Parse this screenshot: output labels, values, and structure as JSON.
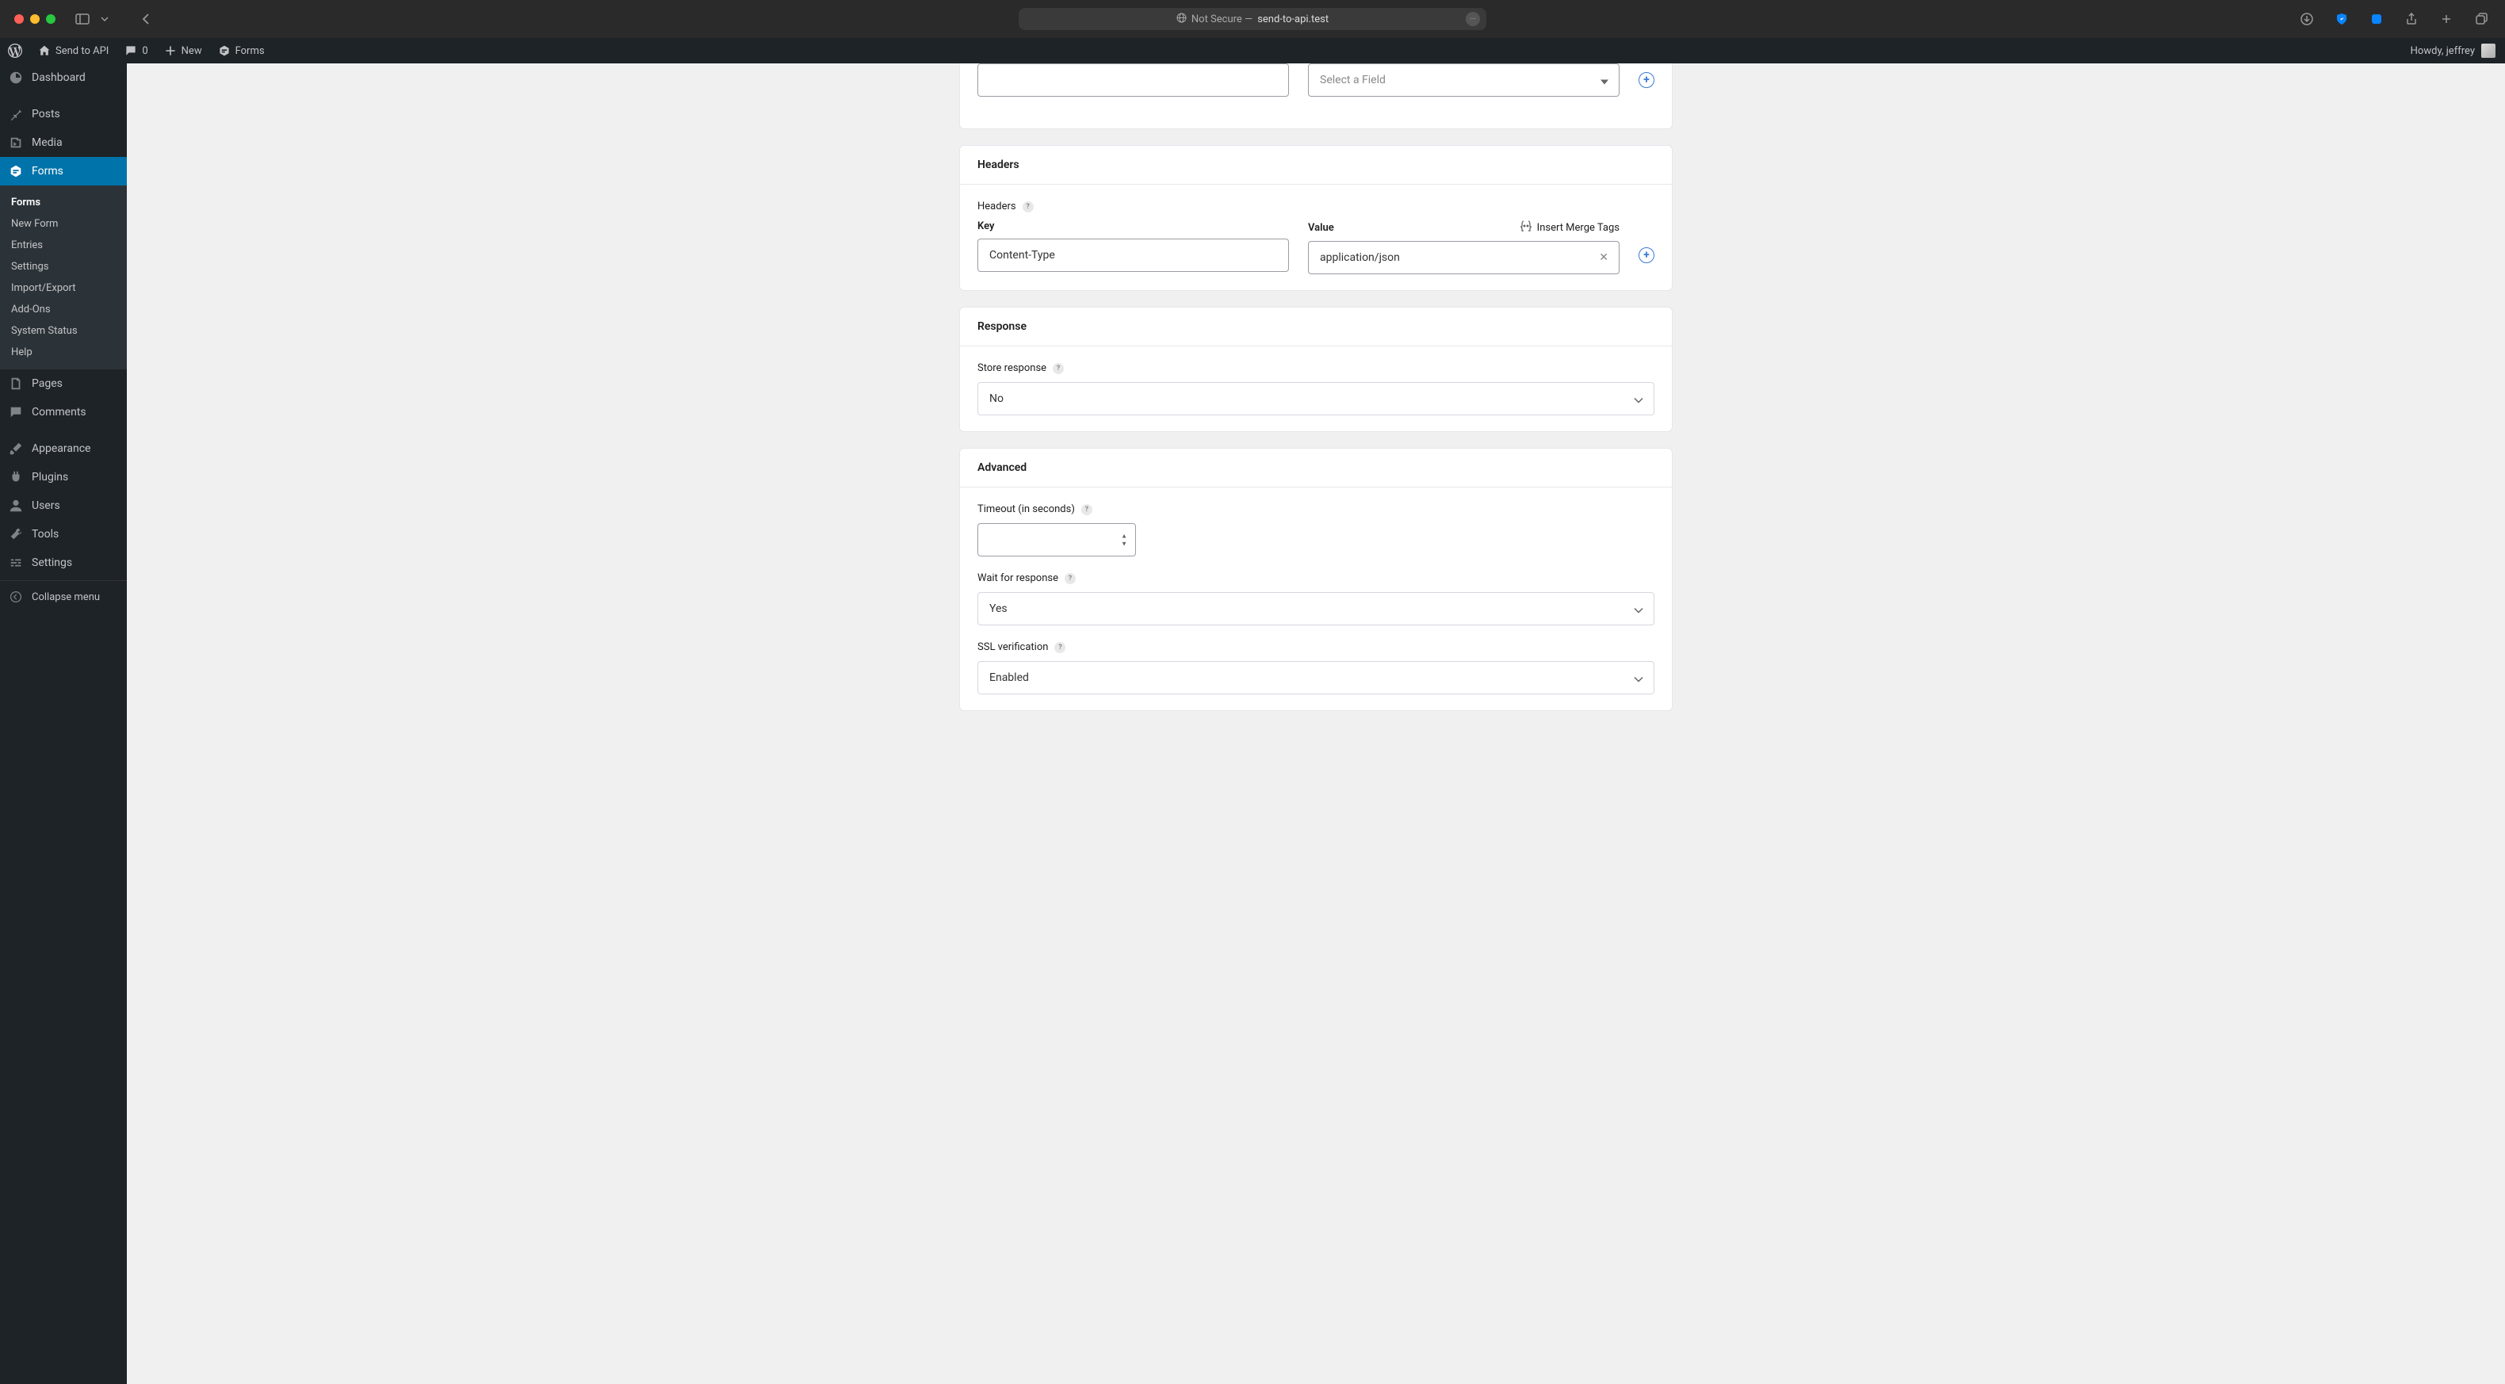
{
  "browser": {
    "url_prefix": "Not Secure —",
    "url": "send-to-api.test"
  },
  "adminbar": {
    "site_name": "Send to API",
    "comments_count": "0",
    "new_label": "New",
    "forms_label": "Forms",
    "howdy": "Howdy, jeffrey"
  },
  "sidebar": {
    "dashboard": "Dashboard",
    "posts": "Posts",
    "media": "Media",
    "forms": "Forms",
    "submenu": {
      "forms": "Forms",
      "new_form": "New Form",
      "entries": "Entries",
      "settings": "Settings",
      "import_export": "Import/Export",
      "addons": "Add-Ons",
      "system_status": "System Status",
      "help": "Help"
    },
    "pages": "Pages",
    "comments": "Comments",
    "appearance": "Appearance",
    "plugins": "Plugins",
    "users": "Users",
    "tools": "Tools",
    "settings": "Settings",
    "collapse": "Collapse menu"
  },
  "top_row": {
    "select_placeholder": "Select a Field"
  },
  "headers_panel": {
    "title": "Headers",
    "label": "Headers",
    "key_label": "Key",
    "value_label": "Value",
    "merge_tags": "Insert Merge Tags",
    "key_value": "Content-Type",
    "value_value": "application/json"
  },
  "response_panel": {
    "title": "Response",
    "store_label": "Store response",
    "store_value": "No"
  },
  "advanced_panel": {
    "title": "Advanced",
    "timeout_label": "Timeout (in seconds)",
    "timeout_value": "",
    "wait_label": "Wait for response",
    "wait_value": "Yes",
    "ssl_label": "SSL verification",
    "ssl_value": "Enabled"
  }
}
